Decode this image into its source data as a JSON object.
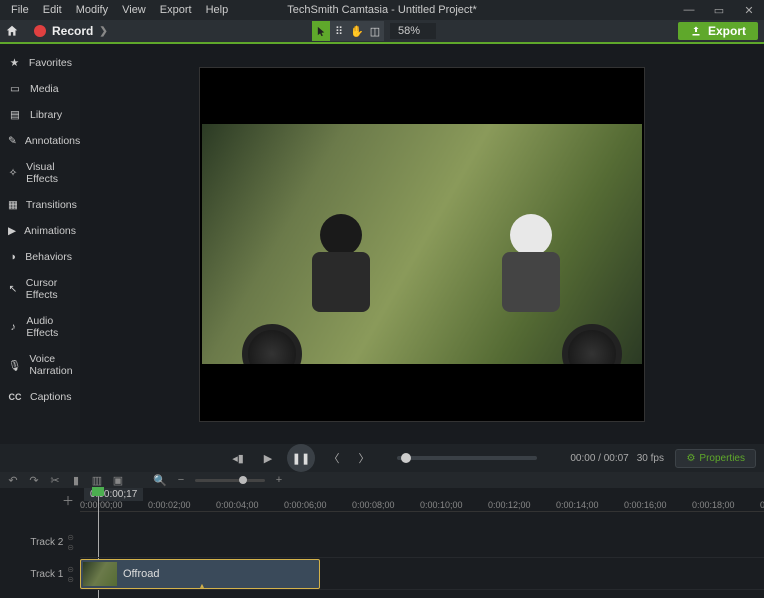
{
  "title": "TechSmith Camtasia - Untitled Project*",
  "menu": [
    "File",
    "Edit",
    "Modify",
    "View",
    "Export",
    "Help"
  ],
  "toolbar": {
    "record": "Record",
    "zoom": "58%",
    "export": "Export"
  },
  "sidebar": [
    {
      "icon": "★",
      "label": "Favorites"
    },
    {
      "icon": "▭",
      "label": "Media"
    },
    {
      "icon": "▤",
      "label": "Library"
    },
    {
      "icon": "✎",
      "label": "Annotations"
    },
    {
      "icon": "✧",
      "label": "Visual Effects"
    },
    {
      "icon": "▦",
      "label": "Transitions"
    },
    {
      "icon": "▶",
      "label": "Animations"
    },
    {
      "icon": "◑",
      "label": "Behaviors"
    },
    {
      "icon": "↖",
      "label": "Cursor Effects"
    },
    {
      "icon": "♪",
      "label": "Audio Effects"
    },
    {
      "icon": "🎙",
      "label": "Voice Narration"
    },
    {
      "icon": "CC",
      "label": "Captions"
    }
  ],
  "playback": {
    "time": "00:00 / 00:07",
    "fps": "30 fps",
    "properties": "Properties"
  },
  "timeline": {
    "playhead_time": "0:00:00;17",
    "ticks": [
      "0:00:00;00",
      "0:00:02;00",
      "0:00:04;00",
      "0:00:06;00",
      "0:00:08;00",
      "0:00:10;00",
      "0:00:12;00",
      "0:00:14;00",
      "0:00:16;00",
      "0:00:18;00",
      "0"
    ],
    "tracks": [
      "Track 2",
      "Track 1"
    ],
    "clip_label": "Offroad"
  }
}
